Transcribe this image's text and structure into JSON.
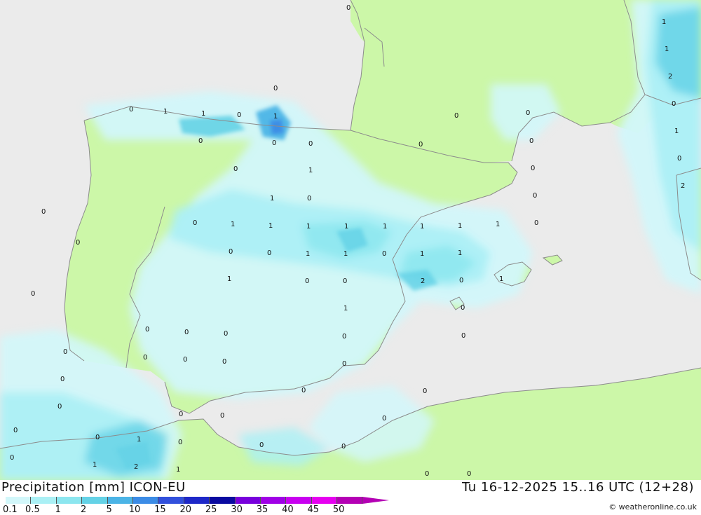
{
  "title_left": "Precipitation [mm] ICON-EU",
  "title_right": "Tu 16-12-2025 15..16 UTC (12+28)",
  "credit": "© weatheronline.co.uk",
  "colors": {
    "sea": "#ebebeb",
    "land": "#ccf7a8",
    "border": "#8c8c8c"
  },
  "legend": {
    "labels": [
      "0.1",
      "0.5",
      "1",
      "2",
      "5",
      "10",
      "15",
      "20",
      "25",
      "30",
      "35",
      "40",
      "45",
      "50"
    ],
    "colors": [
      "#d2f7fa",
      "#aaf0f5",
      "#8ce6ef",
      "#64d2e6",
      "#4bb4e6",
      "#3c8ce6",
      "#3250dc",
      "#1e28c8",
      "#0a0aa0",
      "#7800dc",
      "#a000e6",
      "#c800f0",
      "#e600f0",
      "#b400b4"
    ]
  },
  "map_values": [
    "0",
    "1",
    "1",
    "0",
    "1",
    "0",
    "0",
    "0",
    "1",
    "0",
    "0",
    "0",
    "0",
    "0",
    "0",
    "1",
    "0",
    "1",
    "1",
    "1",
    "1",
    "1",
    "1",
    "1",
    "0",
    "0",
    "1",
    "1",
    "0",
    "1",
    "1",
    "0",
    "1",
    "0",
    "0",
    "2",
    "0",
    "0",
    "1",
    "0",
    "0",
    "0",
    "0",
    "0",
    "0",
    "0",
    "0",
    "0",
    "0",
    "0",
    "0",
    "0",
    "0",
    "0",
    "0",
    "0",
    "0",
    "0",
    "0",
    "0",
    "0",
    "0",
    "0",
    "0",
    "0",
    "0",
    "1",
    "2",
    "1",
    "0",
    "1",
    "1",
    "1",
    "2",
    "0",
    "1",
    "0",
    "0",
    "0",
    "0",
    "2",
    "0",
    "1",
    "1"
  ]
}
